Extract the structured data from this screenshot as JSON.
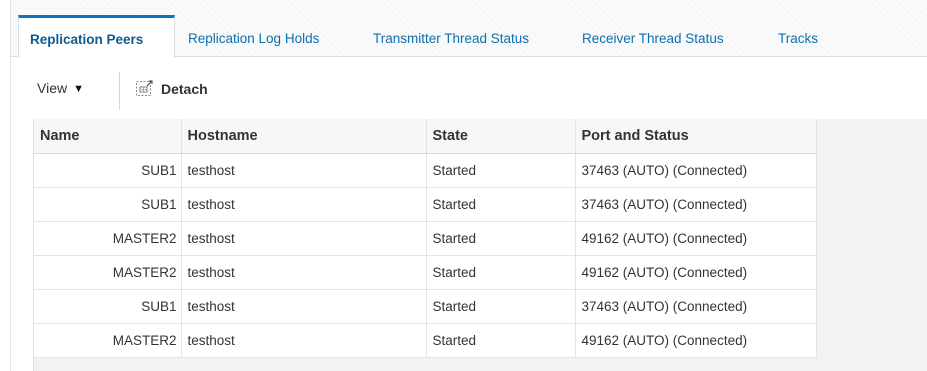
{
  "tabs": [
    {
      "label": "Replication Peers",
      "active": true
    },
    {
      "label": "Replication Log Holds",
      "active": false
    },
    {
      "label": "Transmitter Thread Status",
      "active": false
    },
    {
      "label": "Receiver Thread Status",
      "active": false
    },
    {
      "label": "Tracks",
      "active": false
    }
  ],
  "toolbar": {
    "view_label": "View",
    "view_icon": "caret-down-icon",
    "detach_label": "Detach",
    "detach_icon": "detach-icon"
  },
  "table": {
    "columns": [
      "Name",
      "Hostname",
      "State",
      "Port and Status"
    ],
    "rows": [
      {
        "name": "SUB1",
        "hostname": "testhost",
        "state": "Started",
        "port_status": "37463 (AUTO) (Connected)"
      },
      {
        "name": "SUB1",
        "hostname": "testhost",
        "state": "Started",
        "port_status": "37463 (AUTO) (Connected)"
      },
      {
        "name": "MASTER2",
        "hostname": "testhost",
        "state": "Started",
        "port_status": "49162 (AUTO) (Connected)"
      },
      {
        "name": "MASTER2",
        "hostname": "testhost",
        "state": "Started",
        "port_status": "49162 (AUTO) (Connected)"
      },
      {
        "name": "SUB1",
        "hostname": "testhost",
        "state": "Started",
        "port_status": "37463 (AUTO) (Connected)"
      },
      {
        "name": "MASTER2",
        "hostname": "testhost",
        "state": "Started",
        "port_status": "49162 (AUTO) (Connected)"
      }
    ]
  },
  "colors": {
    "tab_link": "#0b6fb0",
    "tab_active_text": "#0f5a8f",
    "tab_active_border": "#0b74c5",
    "text": "#333333",
    "table_header_bg": "#f7f7f7",
    "table_area_bg": "#f2f2f2"
  }
}
